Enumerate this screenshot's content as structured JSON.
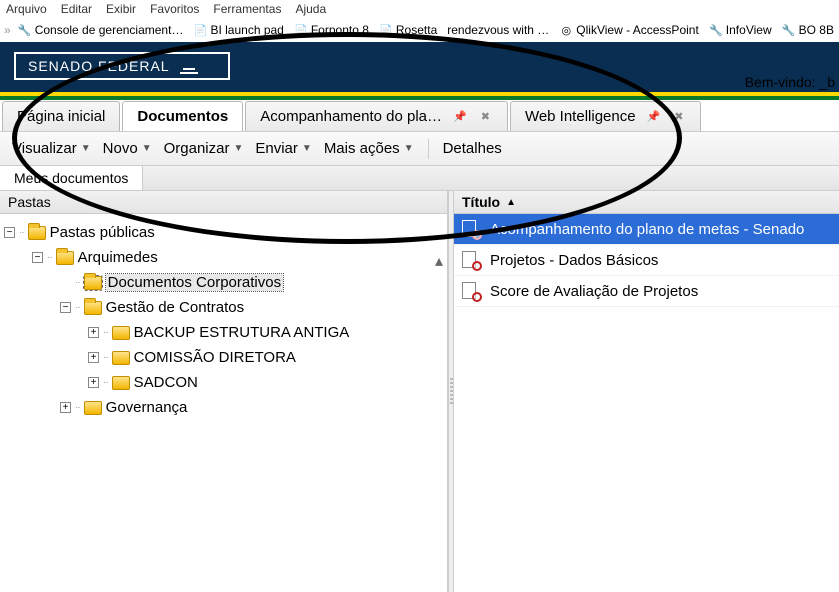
{
  "menubar": [
    "Arquivo",
    "Editar",
    "Exibir",
    "Favoritos",
    "Ferramentas",
    "Ajuda"
  ],
  "bookmarks": [
    {
      "label": "Console de gerenciament…",
      "icon": "🔧"
    },
    {
      "label": "BI launch pad",
      "icon": "📄"
    },
    {
      "label": "Forponto 8",
      "icon": "📄"
    },
    {
      "label": "Rosetta",
      "icon": "📄"
    },
    {
      "label": "rendezvous with …",
      "icon": ""
    },
    {
      "label": "QlikView - AccessPoint",
      "icon": "◎"
    },
    {
      "label": "InfoView",
      "icon": "🔧"
    },
    {
      "label": "BO 8B",
      "icon": "🔧"
    }
  ],
  "brand": "SENADO FEDERAL",
  "welcome": {
    "prefix": "Bem-vindo:",
    "user": "_b"
  },
  "tabs": [
    {
      "label": "Página inicial",
      "active": false,
      "closable": false
    },
    {
      "label": "Documentos",
      "active": true,
      "closable": false
    },
    {
      "label": "Acompanhamento do pla…",
      "active": false,
      "closable": true
    },
    {
      "label": "Web Intelligence",
      "active": false,
      "closable": true
    }
  ],
  "toolbar": {
    "visualizar": "Visualizar",
    "novo": "Novo",
    "organizar": "Organizar",
    "enviar": "Enviar",
    "mais": "Mais ações",
    "detalhes": "Detalhes"
  },
  "subtabs": {
    "meusdocs": "Meus documentos"
  },
  "tree_head": "Pastas",
  "tree": {
    "root": "Pastas públicas",
    "arquimedes": "Arquimedes",
    "doccorp": "Documentos Corporativos",
    "gestao": "Gestão de Contratos",
    "backup": "BACKUP ESTRUTURA ANTIGA",
    "comissao": "COMISSÃO DIRETORA",
    "sadcon": "SADCON",
    "governanca": "Governança"
  },
  "list": {
    "header": "Título",
    "rows": [
      "Acompanhamento do plano de metas - Senado",
      "Projetos - Dados Básicos",
      "Score de Avaliação de Projetos"
    ]
  }
}
